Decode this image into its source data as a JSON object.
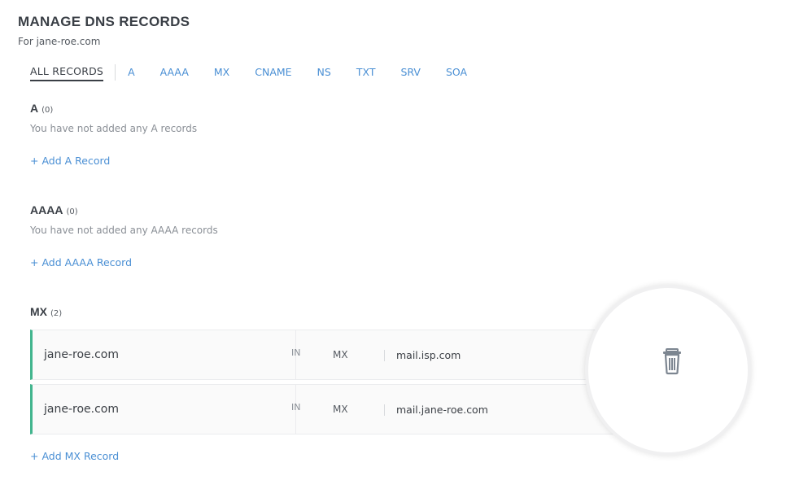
{
  "header": {
    "title": "MANAGE DNS RECORDS",
    "subtitle": "For jane-roe.com"
  },
  "tabs": [
    {
      "label": "ALL RECORDS",
      "active": true
    },
    {
      "label": "A"
    },
    {
      "label": "AAAA"
    },
    {
      "label": "MX"
    },
    {
      "label": "CNAME"
    },
    {
      "label": "NS"
    },
    {
      "label": "TXT"
    },
    {
      "label": "SRV"
    },
    {
      "label": "SOA"
    }
  ],
  "sections": {
    "a": {
      "title": "A",
      "count": "(0)",
      "empty_message": "You have not added any A records",
      "add_label": "+ Add A Record"
    },
    "aaaa": {
      "title": "AAAA",
      "count": "(0)",
      "empty_message": "You have not added any AAAA records",
      "add_label": "+ Add AAAA Record"
    },
    "mx": {
      "title": "MX",
      "count": "(2)",
      "add_label": "+ Add MX Record",
      "records": [
        {
          "host": "jane-roe.com",
          "class": "IN",
          "type": "MX",
          "value": "mail.isp.com"
        },
        {
          "host": "jane-roe.com",
          "class": "IN",
          "type": "MX",
          "value": "mail.jane-roe.com"
        }
      ]
    }
  },
  "icons": {
    "delete": "trash-icon"
  },
  "colors": {
    "accent": "#4a8fd4",
    "record_bar": "#43b58e",
    "text_dark": "#3a3f46",
    "muted": "#8a8f96"
  }
}
